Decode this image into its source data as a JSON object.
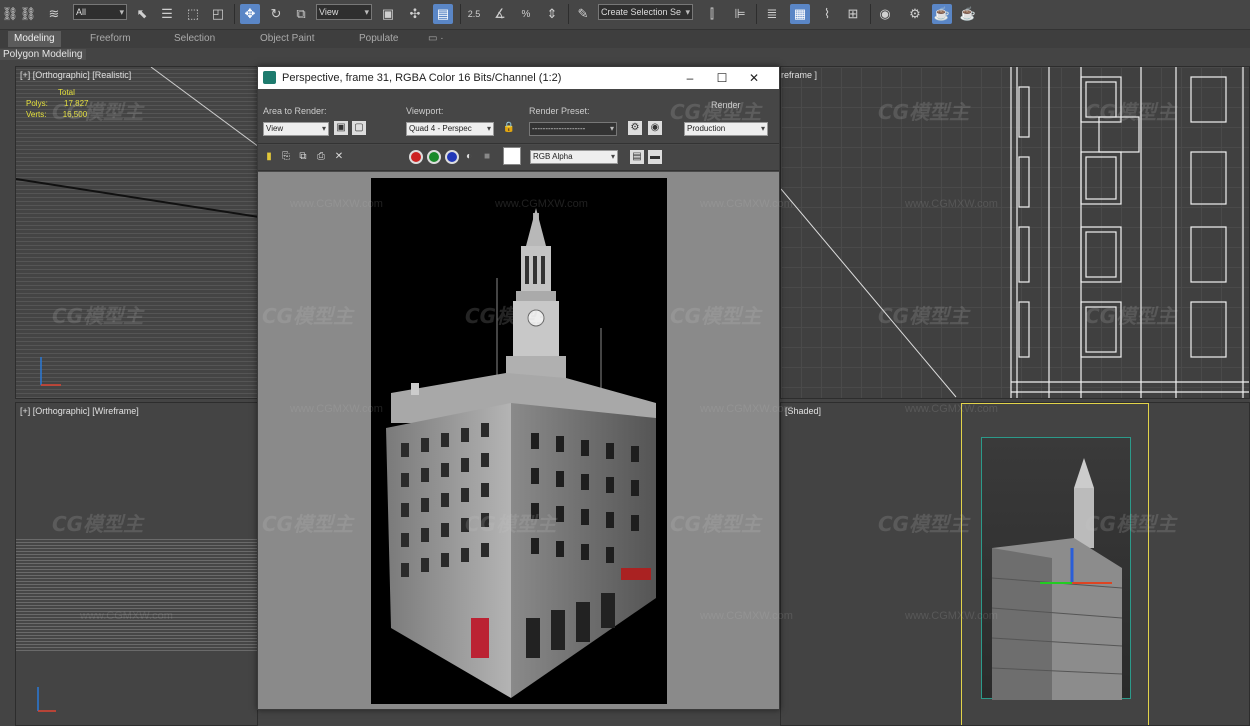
{
  "toolbar": {
    "selection_filter": "All",
    "ref_coord": "View",
    "named_selection": "Create Selection Se",
    "snap_labels": [
      "2.5",
      "%"
    ]
  },
  "ribbon": {
    "tabs": [
      "Modeling",
      "Freeform",
      "Selection",
      "Object Paint",
      "Populate"
    ],
    "sub_label": "Polygon Modeling"
  },
  "viewports": {
    "top_left": {
      "label": "[+] [Orthographic] [Realistic]",
      "stats": {
        "total_label": "Total",
        "polys_label": "Polys:",
        "polys": "17,827",
        "verts_label": "Verts:",
        "verts": "16,500"
      }
    },
    "top_right": {
      "label": "reframe ]"
    },
    "bottom_left": {
      "label": "[+] [Orthographic] [Wireframe]"
    },
    "bottom_right": {
      "label": "[Shaded]"
    }
  },
  "render_frame": {
    "title": "Perspective, frame 31, RGBA Color 16 Bits/Channel (1:2)",
    "area_to_render_label": "Area to Render:",
    "area_to_render_value": "View",
    "viewport_label": "Viewport:",
    "viewport_value": "Quad 4 - Perspec",
    "render_preset_label": "Render Preset:",
    "render_preset_value": "--------------------",
    "render_label": "Render",
    "render_value": "Production",
    "channel_value": "RGB Alpha"
  },
  "watermark": {
    "brand": "CG模型主",
    "url": "www.CGMXW.com"
  },
  "colors": {
    "accent": "#5a86c6",
    "stats_yellow": "#e6e13c",
    "selection_yellow": "#e2d34a"
  }
}
